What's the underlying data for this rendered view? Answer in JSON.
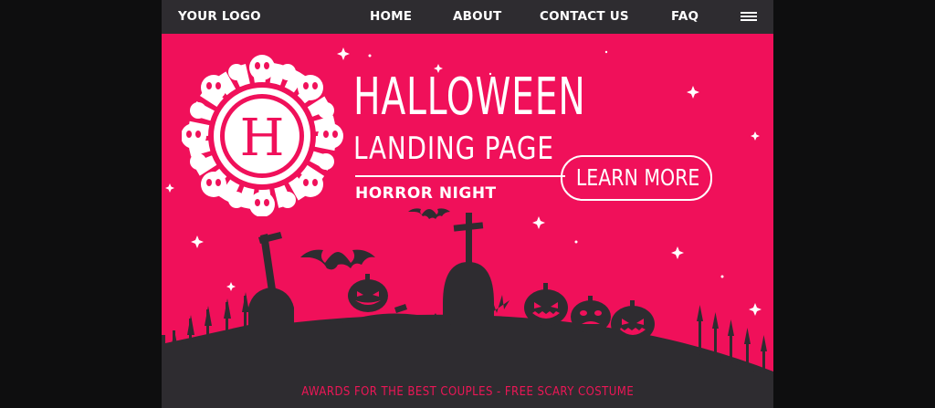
{
  "nav": {
    "logo": "YOUR LOGO",
    "links": [
      "HOME",
      "ABOUT",
      "CONTACT US",
      "FAQ"
    ],
    "menu_icon": "hamburger-icon"
  },
  "hero": {
    "emblem_letter": "H",
    "title_line1": "HALLOWEEN",
    "title_line2": "LANDING PAGE",
    "subtitle": "HORROR NIGHT",
    "cta_label": "LEARN MORE"
  },
  "footer": {
    "tagline": "AWARDS FOR THE BEST COUPLES - FREE SCARY COSTUME"
  },
  "colors": {
    "accent": "#f0105a",
    "dark": "#2e2c30",
    "page_bg": "#0e0e0f",
    "text": "#ffffff"
  }
}
